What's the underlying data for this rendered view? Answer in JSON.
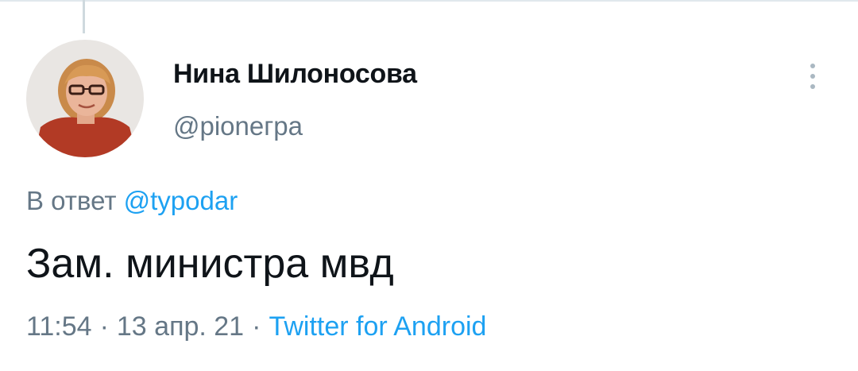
{
  "tweet": {
    "author": {
      "name": "Нина Шилоносова",
      "handle": "@pionегра"
    },
    "reply": {
      "prefix": "В ответ",
      "mention": "@typodar"
    },
    "text": "Зам. министра мвд",
    "meta": {
      "time": "11:54",
      "separator": "·",
      "date": "13 апр. 21",
      "source": "Twitter for Android"
    }
  },
  "icons": {
    "more": "more-vertical-icon",
    "avatar": "profile-photo"
  },
  "colors": {
    "link": "#1da1f2",
    "secondary_text": "#657786",
    "primary_text": "#0f1419"
  }
}
